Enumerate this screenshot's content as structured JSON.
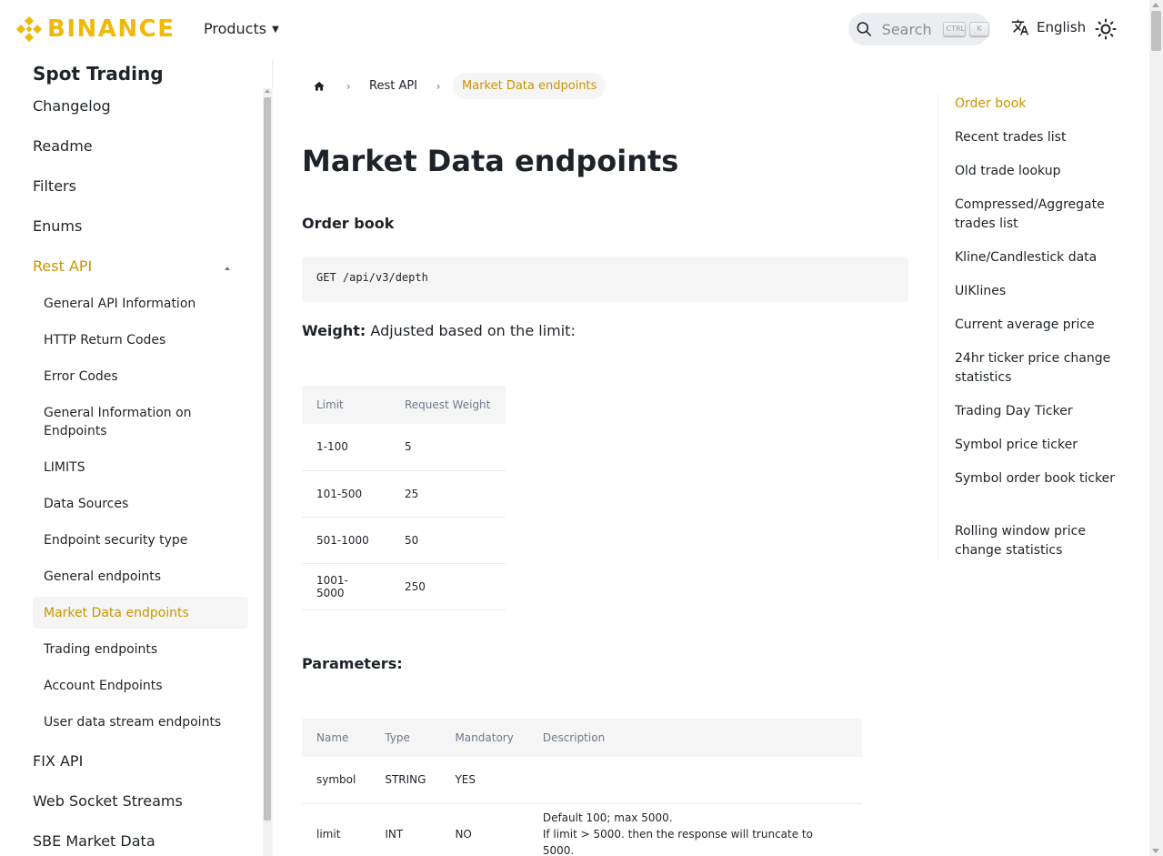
{
  "header": {
    "brand": "BINANCE",
    "products_label": "Products",
    "search": {
      "placeholder": "Search",
      "key1": "CTRL",
      "key2": "K"
    },
    "language_label": "English",
    "accent_color": "#f0b90b"
  },
  "sidebar": {
    "title": "Spot Trading",
    "top_items": [
      {
        "label": "Changelog"
      },
      {
        "label": "Readme"
      },
      {
        "label": "Filters"
      },
      {
        "label": "Enums"
      },
      {
        "label": "Rest API"
      },
      {
        "label": "FIX API"
      },
      {
        "label": "Web Socket Streams"
      },
      {
        "label": "SBE Market Data"
      }
    ],
    "sub_items": [
      {
        "label": "General API Information"
      },
      {
        "label": "HTTP Return Codes"
      },
      {
        "label": "Error Codes"
      },
      {
        "label": "General Information on Endpoints"
      },
      {
        "label": "LIMITS"
      },
      {
        "label": "Data Sources"
      },
      {
        "label": "Endpoint security type"
      },
      {
        "label": "General endpoints"
      },
      {
        "label": "Market Data endpoints"
      },
      {
        "label": "Trading endpoints"
      },
      {
        "label": "Account Endpoints"
      },
      {
        "label": "User data stream endpoints"
      }
    ]
  },
  "breadcrumb": {
    "items": [
      "Rest API",
      "Market Data endpoints"
    ]
  },
  "main": {
    "title": "Market Data endpoints",
    "section_title": "Order book",
    "code": "GET /api/v3/depth",
    "weight_label": "Weight:",
    "weight_text": "Adjusted based on the limit:",
    "weight_table": {
      "headers": [
        "Limit",
        "Request Weight"
      ],
      "rows": [
        [
          "1-100",
          "5"
        ],
        [
          "101-500",
          "25"
        ],
        [
          "501-1000",
          "50"
        ],
        [
          "1001-5000",
          "250"
        ]
      ]
    },
    "params_title": "Parameters:",
    "params_table": {
      "headers": [
        "Name",
        "Type",
        "Mandatory",
        "Description"
      ],
      "rows": [
        [
          "symbol",
          "STRING",
          "YES",
          ""
        ],
        [
          "limit",
          "INT",
          "NO",
          "Default 100; max 5000.",
          "If limit > 5000. then the response will truncate to 5000."
        ]
      ]
    }
  },
  "toc": {
    "items": [
      "Order book",
      "Recent trades list",
      "Old trade lookup",
      "Compressed/Aggregate trades list",
      "Kline/Candlestick data",
      "UIKlines",
      "Current average price",
      "24hr ticker price change statistics",
      "Trading Day Ticker",
      "Symbol price ticker",
      "Symbol order book ticker",
      "Rolling window price change statistics"
    ]
  }
}
